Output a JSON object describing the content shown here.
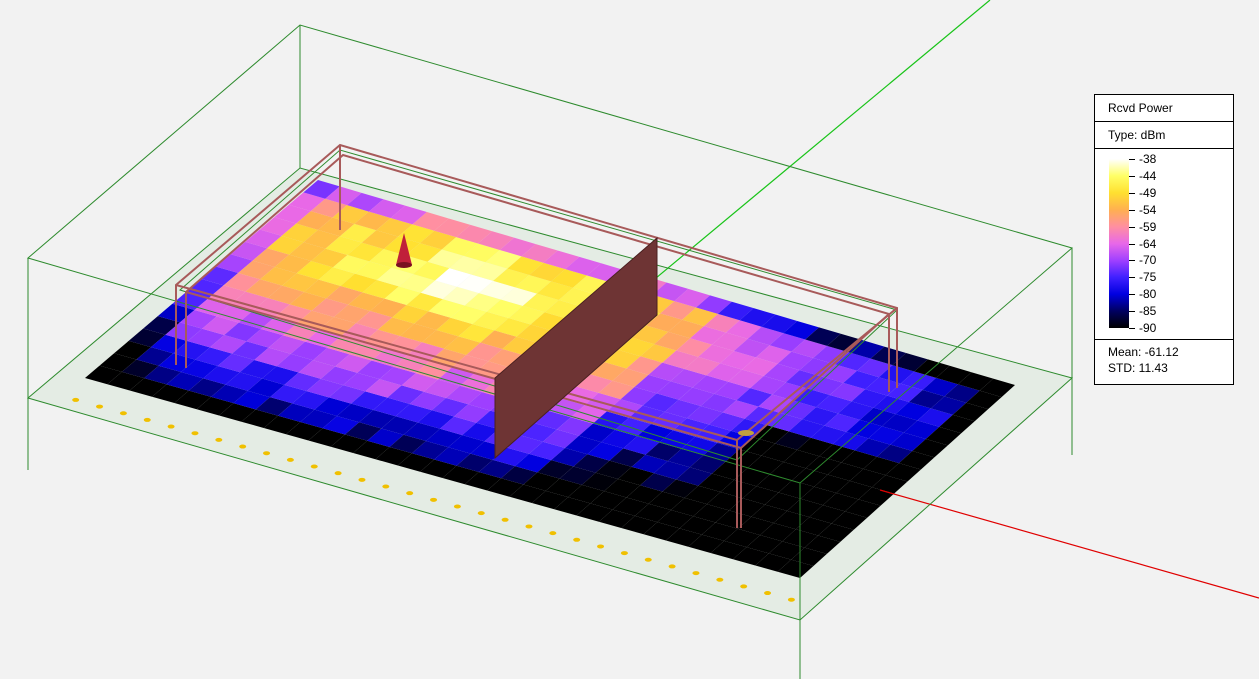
{
  "legend": {
    "title": "Rcvd Power",
    "type_label": "Type: dBm",
    "ticks": [
      "-38",
      "-44",
      "-49",
      "-54",
      "-59",
      "-64",
      "-70",
      "-75",
      "-80",
      "-85",
      "-90"
    ],
    "mean_label": "Mean: -61.12",
    "std_label": "STD: 11.43"
  },
  "colors": {
    "background": "#f2f2f2",
    "axis_x": "#e00000",
    "axis_y": "#19c419",
    "bounding_box": "#2e8b2e",
    "walls": "#a85a5a",
    "partition": "#6e3434",
    "transmitter": "#c0203a",
    "receiver_dot": "#f0c000"
  },
  "colormap": [
    "#ffffff",
    "#ffff66",
    "#ffe030",
    "#ffb050",
    "#ff8fa0",
    "#e868e8",
    "#a040ff",
    "#4020ff",
    "#0000e0",
    "#000060",
    "#000000"
  ],
  "chart_data": {
    "type": "heatmap",
    "title": "Rcvd Power",
    "unit": "dBm",
    "range": [
      -90,
      -38
    ],
    "mean": -61.12,
    "std": 11.43
  }
}
